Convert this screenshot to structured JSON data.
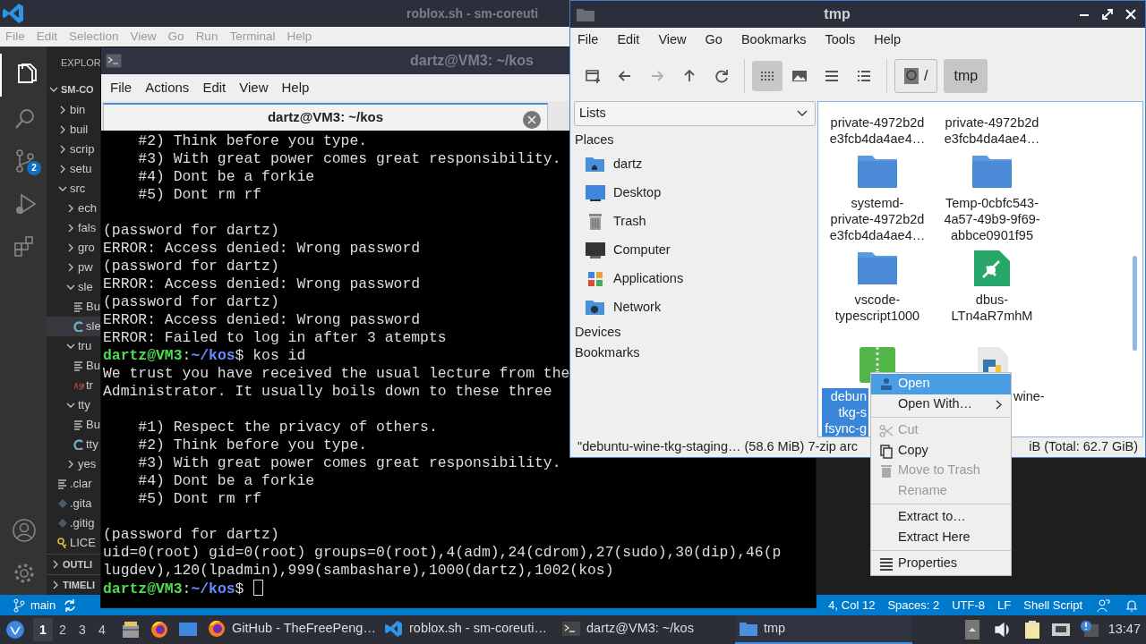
{
  "vscode": {
    "title": "roblox.sh - sm-coreuti",
    "menu": [
      "File",
      "Edit",
      "Selection",
      "View",
      "Go",
      "Run",
      "Terminal",
      "Help"
    ],
    "activity": [
      {
        "kind": "files",
        "selected": true
      },
      {
        "kind": "search",
        "selected": false
      },
      {
        "kind": "scm",
        "selected": false,
        "badge": "2"
      },
      {
        "kind": "debug",
        "selected": false
      },
      {
        "kind": "extensions",
        "selected": false
      }
    ],
    "activity_bottom": [
      {
        "kind": "account"
      },
      {
        "kind": "settings"
      }
    ],
    "explorer": {
      "title": "EXPLOR",
      "root": {
        "label": "SM-CO",
        "expanded": true
      },
      "tree": [
        {
          "label": "bin",
          "expanded": false,
          "selected": false
        },
        {
          "label": "buil",
          "expanded": false,
          "selected": false
        },
        {
          "label": "scrip",
          "expanded": false,
          "selected": false
        },
        {
          "label": "setu",
          "expanded": false,
          "selected": false
        },
        {
          "label": "src",
          "expanded": true,
          "selected": false,
          "children": [
            {
              "label": "ech",
              "expanded": false,
              "selected": false
            },
            {
              "label": "fals",
              "expanded": false,
              "selected": false
            },
            {
              "label": "gro",
              "expanded": false,
              "selected": false
            },
            {
              "label": "pw",
              "expanded": false,
              "selected": false
            },
            {
              "label": "sle",
              "expanded": true,
              "selected": false,
              "children": [
                {
                  "label": "Bu",
                  "kind": "text",
                  "selected": false
                },
                {
                  "label": "sle",
                  "kind": "c",
                  "selected": true
                }
              ]
            },
            {
              "label": "tru",
              "expanded": true,
              "selected": false,
              "children": [
                {
                  "label": "Bu",
                  "kind": "text",
                  "selected": false
                },
                {
                  "label": "tr",
                  "kind": "asm",
                  "selected": false
                }
              ]
            },
            {
              "label": "tty",
              "expanded": true,
              "selected": false,
              "children": [
                {
                  "label": "Bu",
                  "kind": "text",
                  "selected": false
                },
                {
                  "label": "tty",
                  "kind": "c",
                  "selected": false
                }
              ]
            },
            {
              "label": "yes",
              "expanded": false,
              "selected": false
            }
          ]
        },
        {
          "label": ".clar",
          "kind": "text",
          "selected": false
        },
        {
          "label": ".gita",
          "kind": "git",
          "selected": false
        },
        {
          "label": ".gitig",
          "kind": "git",
          "selected": false
        },
        {
          "label": "LICE",
          "kind": "license",
          "selected": false
        }
      ],
      "sections": [
        {
          "label": "OUTLI",
          "expanded": false
        },
        {
          "label": "TIMELI",
          "expanded": false
        }
      ]
    },
    "status_left": [
      {
        "kind": "branch",
        "label": "main"
      },
      {
        "kind": "sync"
      }
    ],
    "status_right": [
      "4, Col 12",
      "Spaces: 2",
      "UTF-8",
      "LF",
      "Shell Script"
    ],
    "status_icons": [
      {
        "kind": "feedback"
      },
      {
        "kind": "bell"
      }
    ]
  },
  "terminal": {
    "title": "dartz@VM3: ~/kos",
    "menu": [
      "File",
      "Actions",
      "Edit",
      "View",
      "Help"
    ],
    "tab": {
      "label": "dartz@VM3: ~/kos",
      "selected": true
    },
    "lines": [
      {
        "kind": "text",
        "text": "    #2) Think before you type."
      },
      {
        "kind": "text",
        "text": "    #3) With great power comes great responsibility."
      },
      {
        "kind": "text",
        "text": "    #4) Dont be a forkie"
      },
      {
        "kind": "text",
        "text": "    #5) Dont rm rf"
      },
      {
        "kind": "blank"
      },
      {
        "kind": "text",
        "text": "(password for dartz)"
      },
      {
        "kind": "text",
        "text": "ERROR: Access denied: Wrong password"
      },
      {
        "kind": "text",
        "text": "(password for dartz)"
      },
      {
        "kind": "text",
        "text": "ERROR: Access denied: Wrong password"
      },
      {
        "kind": "text",
        "text": "(password for dartz)"
      },
      {
        "kind": "text",
        "text": "ERROR: Access denied: Wrong password"
      },
      {
        "kind": "text",
        "text": "ERROR: Failed to log in after 3 atempts"
      },
      {
        "kind": "prompt",
        "user": "dartz@VM3",
        "sep": ":",
        "path": "~/kos",
        "sigil": "$",
        "command": "kos id"
      },
      {
        "kind": "text",
        "text": "We trust you have received the usual lecture from the"
      },
      {
        "kind": "text",
        "text": "Administrator. It usually boils down to these three"
      },
      {
        "kind": "blank"
      },
      {
        "kind": "text",
        "text": "    #1) Respect the privacy of others."
      },
      {
        "kind": "text",
        "text": "    #2) Think before you type."
      },
      {
        "kind": "text",
        "text": "    #3) With great power comes great responsibility."
      },
      {
        "kind": "text",
        "text": "    #4) Dont be a forkie"
      },
      {
        "kind": "text",
        "text": "    #5) Dont rm rf"
      },
      {
        "kind": "blank"
      },
      {
        "kind": "text",
        "text": "(password for dartz)"
      },
      {
        "kind": "text",
        "text": "uid=0(root) gid=0(root) groups=0(root),4(adm),24(cdrom),27(sudo),30(dip),46(p"
      },
      {
        "kind": "text",
        "text": "lugdev),120(lpadmin),999(sambashare),1000(dartz),1002(kos)"
      },
      {
        "kind": "prompt",
        "user": "dartz@VM3",
        "sep": ":",
        "path": "~/kos",
        "sigil": "$",
        "cursor": true
      }
    ]
  },
  "files": {
    "title": "tmp",
    "menu": [
      "File",
      "Edit",
      "View",
      "Go",
      "Bookmarks",
      "Tools",
      "Help"
    ],
    "toolbar": [
      {
        "kind": "new-window",
        "disabled": false
      },
      {
        "kind": "back",
        "disabled": false
      },
      {
        "kind": "forward",
        "disabled": true
      },
      {
        "kind": "up",
        "disabled": false
      },
      {
        "kind": "reload",
        "disabled": false
      }
    ],
    "view_modes": [
      {
        "kind": "icons",
        "selected": true
      },
      {
        "kind": "thumbnails",
        "selected": false
      },
      {
        "kind": "compact",
        "selected": false
      },
      {
        "kind": "details",
        "selected": false
      }
    ],
    "path": [
      {
        "kind": "root",
        "label": "/",
        "selected": false
      },
      {
        "kind": "folder",
        "label": "tmp",
        "selected": true
      }
    ],
    "side_select": "Lists",
    "places_header": "Places",
    "places": [
      {
        "kind": "home",
        "label": "dartz"
      },
      {
        "kind": "desktop",
        "label": "Desktop"
      },
      {
        "kind": "trash",
        "label": "Trash"
      },
      {
        "kind": "computer",
        "label": "Computer"
      },
      {
        "kind": "applications",
        "label": "Applications"
      },
      {
        "kind": "network",
        "label": "Network"
      }
    ],
    "sections": [
      "Devices",
      "Bookmarks"
    ],
    "items": [
      {
        "kind": "hidden",
        "lines": [
          "private-4972b2d",
          "e3fcb4da4ae4…"
        ],
        "selected": false
      },
      {
        "kind": "hidden",
        "lines": [
          "private-4972b2d",
          "e3fcb4da4ae4…"
        ],
        "selected": false
      },
      {
        "kind": "folder",
        "lines": [
          "systemd-",
          "private-4972b2d",
          "e3fcb4da4ae4…"
        ],
        "selected": false
      },
      {
        "kind": "folder",
        "lines": [
          "Temp-0cbfc543-",
          "4a57-49b9-9f69-",
          "abbce0901f95"
        ],
        "selected": false
      },
      {
        "kind": "folder",
        "lines": [
          "vscode-",
          "typescript1000"
        ],
        "selected": false
      },
      {
        "kind": "socket",
        "lines": [
          "dbus-",
          "LTn4aR7mhM"
        ],
        "selected": false
      },
      {
        "kind": "archive",
        "lines": [
          "debun",
          "tkg-s",
          "fsync-g"
        ],
        "selected": true
      },
      {
        "kind": "python",
        "lines": [
          "wine-"
        ],
        "selected": false
      }
    ],
    "status": [
      "\"debuntu-wine-tkg-staging… (58.6 MiB) 7-zip arc",
      "iB (Total: 62.7 GiB)"
    ]
  },
  "context_menu": [
    {
      "kind": "open",
      "label": "Open",
      "selected": true,
      "disabled": false
    },
    {
      "kind": "open-with",
      "label": "Open With…",
      "submenu": true,
      "selected": false,
      "disabled": false
    },
    {
      "kind": "separator"
    },
    {
      "kind": "cut",
      "label": "Cut",
      "selected": false,
      "disabled": true
    },
    {
      "kind": "copy",
      "label": "Copy",
      "selected": false,
      "disabled": false
    },
    {
      "kind": "trash",
      "label": "Move to Trash",
      "selected": false,
      "disabled": true
    },
    {
      "kind": "rename",
      "label": "Rename",
      "selected": false,
      "disabled": true
    },
    {
      "kind": "separator"
    },
    {
      "kind": "extract-to",
      "label": "Extract to…",
      "selected": false,
      "disabled": false
    },
    {
      "kind": "extract-here",
      "label": "Extract Here",
      "selected": false,
      "disabled": false
    },
    {
      "kind": "separator"
    },
    {
      "kind": "properties",
      "label": "Properties",
      "selected": false,
      "disabled": false
    }
  ],
  "taskbar": {
    "workspaces": [
      {
        "label": "1",
        "selected": true
      },
      {
        "label": "2",
        "selected": false
      },
      {
        "label": "3",
        "selected": false
      },
      {
        "label": "4",
        "selected": false
      }
    ],
    "launchers": [
      {
        "kind": "files"
      },
      {
        "kind": "firefox"
      },
      {
        "kind": "desktop"
      }
    ],
    "tasks": [
      {
        "kind": "firefox",
        "label": "GitHub - TheFreePeng…",
        "selected": false
      },
      {
        "kind": "vscode",
        "label": "roblox.sh - sm-coreuti…",
        "selected": false
      },
      {
        "kind": "terminal",
        "label": "dartz@VM3: ~/kos",
        "selected": false
      },
      {
        "kind": "folder",
        "label": "tmp",
        "selected": true
      }
    ],
    "tray": [
      {
        "kind": "up"
      },
      {
        "kind": "volume"
      },
      {
        "kind": "clipboard"
      },
      {
        "kind": "network"
      },
      {
        "kind": "notice"
      }
    ],
    "clock": "13:47"
  }
}
